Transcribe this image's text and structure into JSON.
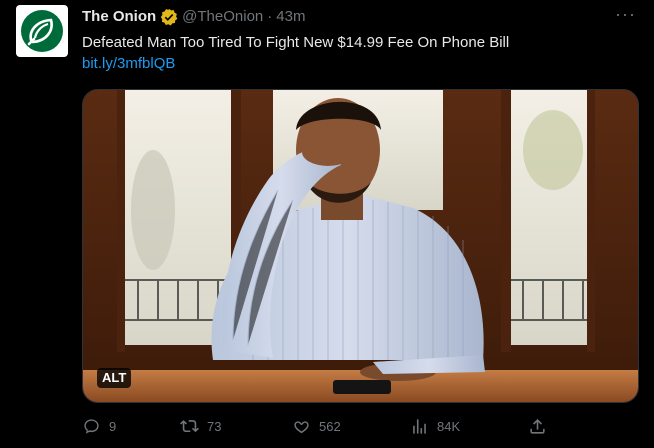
{
  "tweet": {
    "author_name": "The Onion",
    "handle": "@TheOnion",
    "separator": "·",
    "time": "43m",
    "more_label": "···",
    "text": "Defeated Man Too Tired To Fight New $14.99 Fee On Phone Bill",
    "link": "bit.ly/3mfblQB",
    "alt_badge": "ALT"
  },
  "actions": {
    "replies": "9",
    "reposts": "73",
    "likes": "562",
    "views": "84K"
  },
  "colors": {
    "background": "#000000",
    "text": "#e7e9ea",
    "muted": "#71767b",
    "link": "#1d9bf0",
    "verified_gold": "#e2b719",
    "onion_green": "#006b3a"
  },
  "icons": {
    "avatar": "onion-logo-icon",
    "verified": "verified-badge-icon",
    "reply": "reply-icon",
    "repost": "repost-icon",
    "like": "heart-icon",
    "views": "views-bar-chart-icon",
    "share": "share-icon"
  }
}
